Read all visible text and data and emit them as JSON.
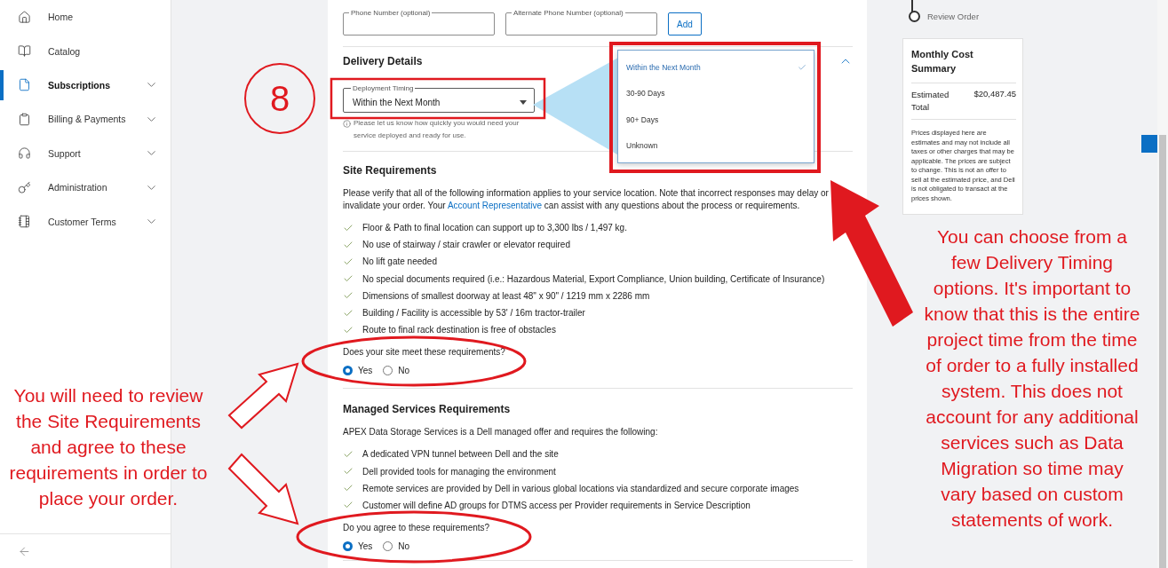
{
  "sidebar": {
    "items": [
      {
        "label": "Home",
        "selected": false,
        "expandable": false
      },
      {
        "label": "Catalog",
        "selected": false,
        "expandable": false
      },
      {
        "label": "Subscriptions",
        "selected": true,
        "expandable": true
      },
      {
        "label": "Billing & Payments",
        "selected": false,
        "expandable": true
      },
      {
        "label": "Support",
        "selected": false,
        "expandable": true
      },
      {
        "label": "Administration",
        "selected": false,
        "expandable": true
      },
      {
        "label": "Customer Terms",
        "selected": false,
        "expandable": true
      }
    ]
  },
  "contact": {
    "phone_label": "Phone Number (optional)",
    "alt_phone_label": "Alternate Phone Number (optional)",
    "add_button": "Add"
  },
  "delivery": {
    "title": "Delivery Details",
    "expanded": true,
    "select": {
      "label": "Deployment Timing",
      "value": "Within the Next Month",
      "open": true
    },
    "helper": "Please let us know how quickly you would need your service deployed and ready for use.",
    "options": [
      {
        "label": "Within the Next Month",
        "selected": true
      },
      {
        "label": "30-90 Days",
        "selected": false
      },
      {
        "label": "90+ Days",
        "selected": false
      },
      {
        "label": "Unknown",
        "selected": false
      }
    ]
  },
  "sections": [
    {
      "title": "Site Requirements",
      "intro": [
        {
          "kind": "text",
          "text": "Please verify that all of the following information applies to your service location. Note that incorrect responses may delay or invalidate your order. Your "
        },
        {
          "kind": "link",
          "text": "Account Representative"
        },
        {
          "kind": "text",
          "text": " can assist with any questions about the process or requirements."
        }
      ],
      "checklist": [
        "Floor & Path to final location can support up to 3,300 lbs / 1,497 kg.",
        "No use of stairway / stair crawler or elevator required",
        "No lift gate needed",
        "No special documents required (i.e.: Hazardous Material, Export Compliance, Union building, Certificate of Insurance)",
        "Dimensions of smallest doorway at least 48\" x 90\" / 1219 mm x 2286 mm",
        "Building / Facility is accessible by 53' / 16m tractor-trailer",
        "Route to final rack destination is free of obstacles"
      ],
      "question": "Does your site meet these requirements?",
      "answers": [
        {
          "label": "Yes",
          "selected": true
        },
        {
          "label": "No",
          "selected": false
        }
      ]
    },
    {
      "title": "Managed Services Requirements",
      "intro": [
        {
          "kind": "text",
          "text": "APEX Data Storage Services is a Dell managed offer and requires the following:"
        }
      ],
      "checklist": [
        "A dedicated VPN tunnel between Dell and the site",
        "Dell provided tools for managing the environment",
        "Remote services are provided by Dell in various global locations via standardized and secure corporate images",
        "Customer will define AD groups for DTMS access per Provider requirements in Service Description"
      ],
      "question": "Do you agree to these requirements?",
      "answers": [
        {
          "label": "Yes",
          "selected": true
        },
        {
          "label": "No",
          "selected": false
        }
      ]
    }
  ],
  "steps": [
    {
      "label": "Review Order"
    }
  ],
  "summary": {
    "title": "Monthly Cost Summary",
    "total_label": "Estimated Total",
    "total_value": "$20,487.45",
    "disclaimer": "Prices displayed here are estimates and may not include all taxes or other charges that may be applicable. The prices are subject to change. This is not an offer to sell at the estimated price, and Dell is not obligated to transact at the prices shown."
  },
  "annotations": {
    "step_badge": "8",
    "callouts": [
      {
        "text": "You will need to review the Site Requirements and agree to these requirements in order to place your order."
      },
      {
        "text": "You can choose from a few Delivery Timing options. It's important to know that this is the entire project time from the time of order to a fully installed system. This does not account for any additional services such as Data Migration so time may vary based on custom statements of work."
      }
    ]
  }
}
